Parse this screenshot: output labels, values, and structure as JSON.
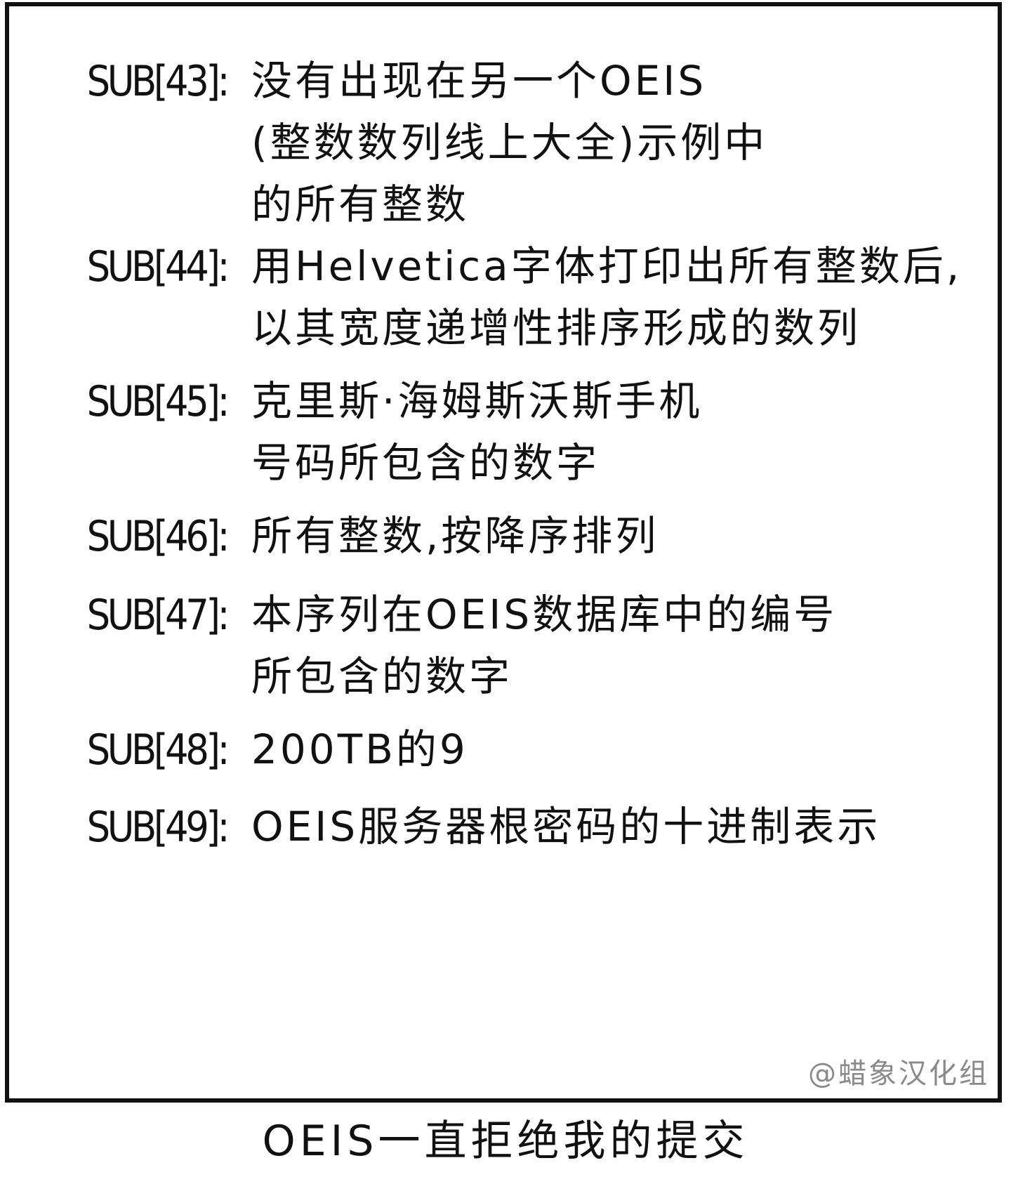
{
  "entries": [
    {
      "label": "SUB[43]:",
      "lines": [
        "没有出现在另一个OEIS",
        "(整数数列线上大全)示例中",
        "的所有整数"
      ]
    },
    {
      "label": "SUB[44]:",
      "lines": [
        "用Helvetica字体打印出所有整数后,",
        "以其宽度递增性排序形成的数列"
      ]
    },
    {
      "label": "SUB[45]:",
      "lines": [
        "克里斯·海姆斯沃斯手机",
        "号码所包含的数字"
      ]
    },
    {
      "label": "SUB[46]:",
      "lines": [
        "所有整数,按降序排列"
      ]
    },
    {
      "label": "SUB[47]:",
      "lines": [
        "本序列在OEIS数据库中的编号",
        "所包含的数字"
      ]
    },
    {
      "label": "SUB[48]:",
      "lines": [
        "200TB的9"
      ]
    },
    {
      "label": "SUB[49]:",
      "lines": [
        "OEIS服务器根密码的十进制表示"
      ]
    }
  ],
  "watermark": "@蜡象汉化组",
  "caption": "OEIS一直拒绝我的提交"
}
